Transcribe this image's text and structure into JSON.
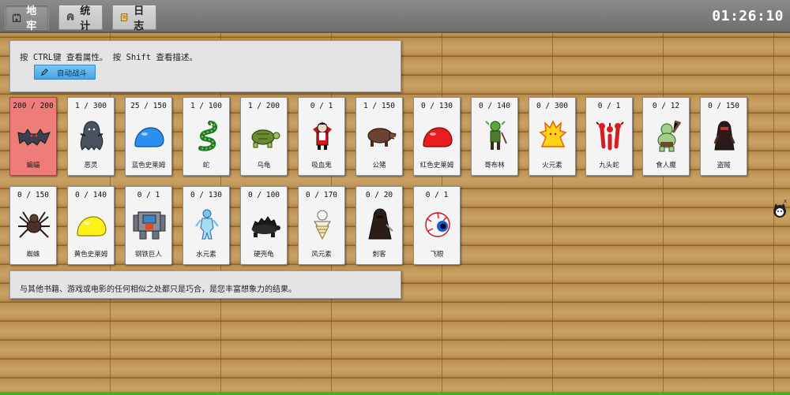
{
  "nav": {
    "dungeon": "地牢",
    "stats": "统计",
    "log": "日志"
  },
  "clock": "01:26:10",
  "hint": {
    "text": "按 CTRL键 查看属性。 按 Shift 查看描述。",
    "auto_fight": "自动战斗"
  },
  "note": "与其他书籍、游戏或电影的任何相似之处都只是巧合，是您丰富想象力的结果。",
  "monsters": [
    {
      "hp": "200 / 200",
      "name": "蝙蝠",
      "icon": "bat-icon"
    },
    {
      "hp": "1 / 300",
      "name": "恶灵",
      "icon": "wraith-icon"
    },
    {
      "hp": "25 / 150",
      "name": "蓝色史莱姆",
      "icon": "blue-slime-icon"
    },
    {
      "hp": "1 / 100",
      "name": "蛇",
      "icon": "snake-icon"
    },
    {
      "hp": "1 / 200",
      "name": "乌龟",
      "icon": "turtle-icon"
    },
    {
      "hp": "0 / 1",
      "name": "吸血鬼",
      "icon": "vampire-icon"
    },
    {
      "hp": "1 / 150",
      "name": "公猪",
      "icon": "boar-icon"
    },
    {
      "hp": "0 / 130",
      "name": "红色史莱姆",
      "icon": "red-slime-icon"
    },
    {
      "hp": "0 / 140",
      "name": "哥布林",
      "icon": "goblin-icon"
    },
    {
      "hp": "0 / 300",
      "name": "火元素",
      "icon": "fire-elemental-icon"
    },
    {
      "hp": "0 / 1",
      "name": "九头蛇",
      "icon": "hydra-icon"
    },
    {
      "hp": "0 / 12",
      "name": "食人魔",
      "icon": "ogre-icon"
    },
    {
      "hp": "0 / 150",
      "name": "盗贼",
      "icon": "thief-icon"
    },
    {
      "hp": "0 / 150",
      "name": "蜘蛛",
      "icon": "spider-icon"
    },
    {
      "hp": "0 / 140",
      "name": "黄色史莱姆",
      "icon": "yellow-slime-icon"
    },
    {
      "hp": "0 / 1",
      "name": "钢铁巨人",
      "icon": "iron-golem-icon"
    },
    {
      "hp": "0 / 130",
      "name": "水元素",
      "icon": "water-elemental-icon"
    },
    {
      "hp": "0 / 100",
      "name": "硬壳龟",
      "icon": "hard-shell-turtle-icon"
    },
    {
      "hp": "0 / 170",
      "name": "风元素",
      "icon": "wind-elemental-icon"
    },
    {
      "hp": "0 / 20",
      "name": "刺客",
      "icon": "assassin-icon"
    },
    {
      "hp": "0 / 1",
      "name": "飞眼",
      "icon": "flying-eye-icon"
    }
  ],
  "side": {
    "close": "x"
  },
  "colors": {
    "active_card": "#ee7d7a",
    "auto_fight_button": "#46a4e1",
    "grass": "#46b31d"
  }
}
